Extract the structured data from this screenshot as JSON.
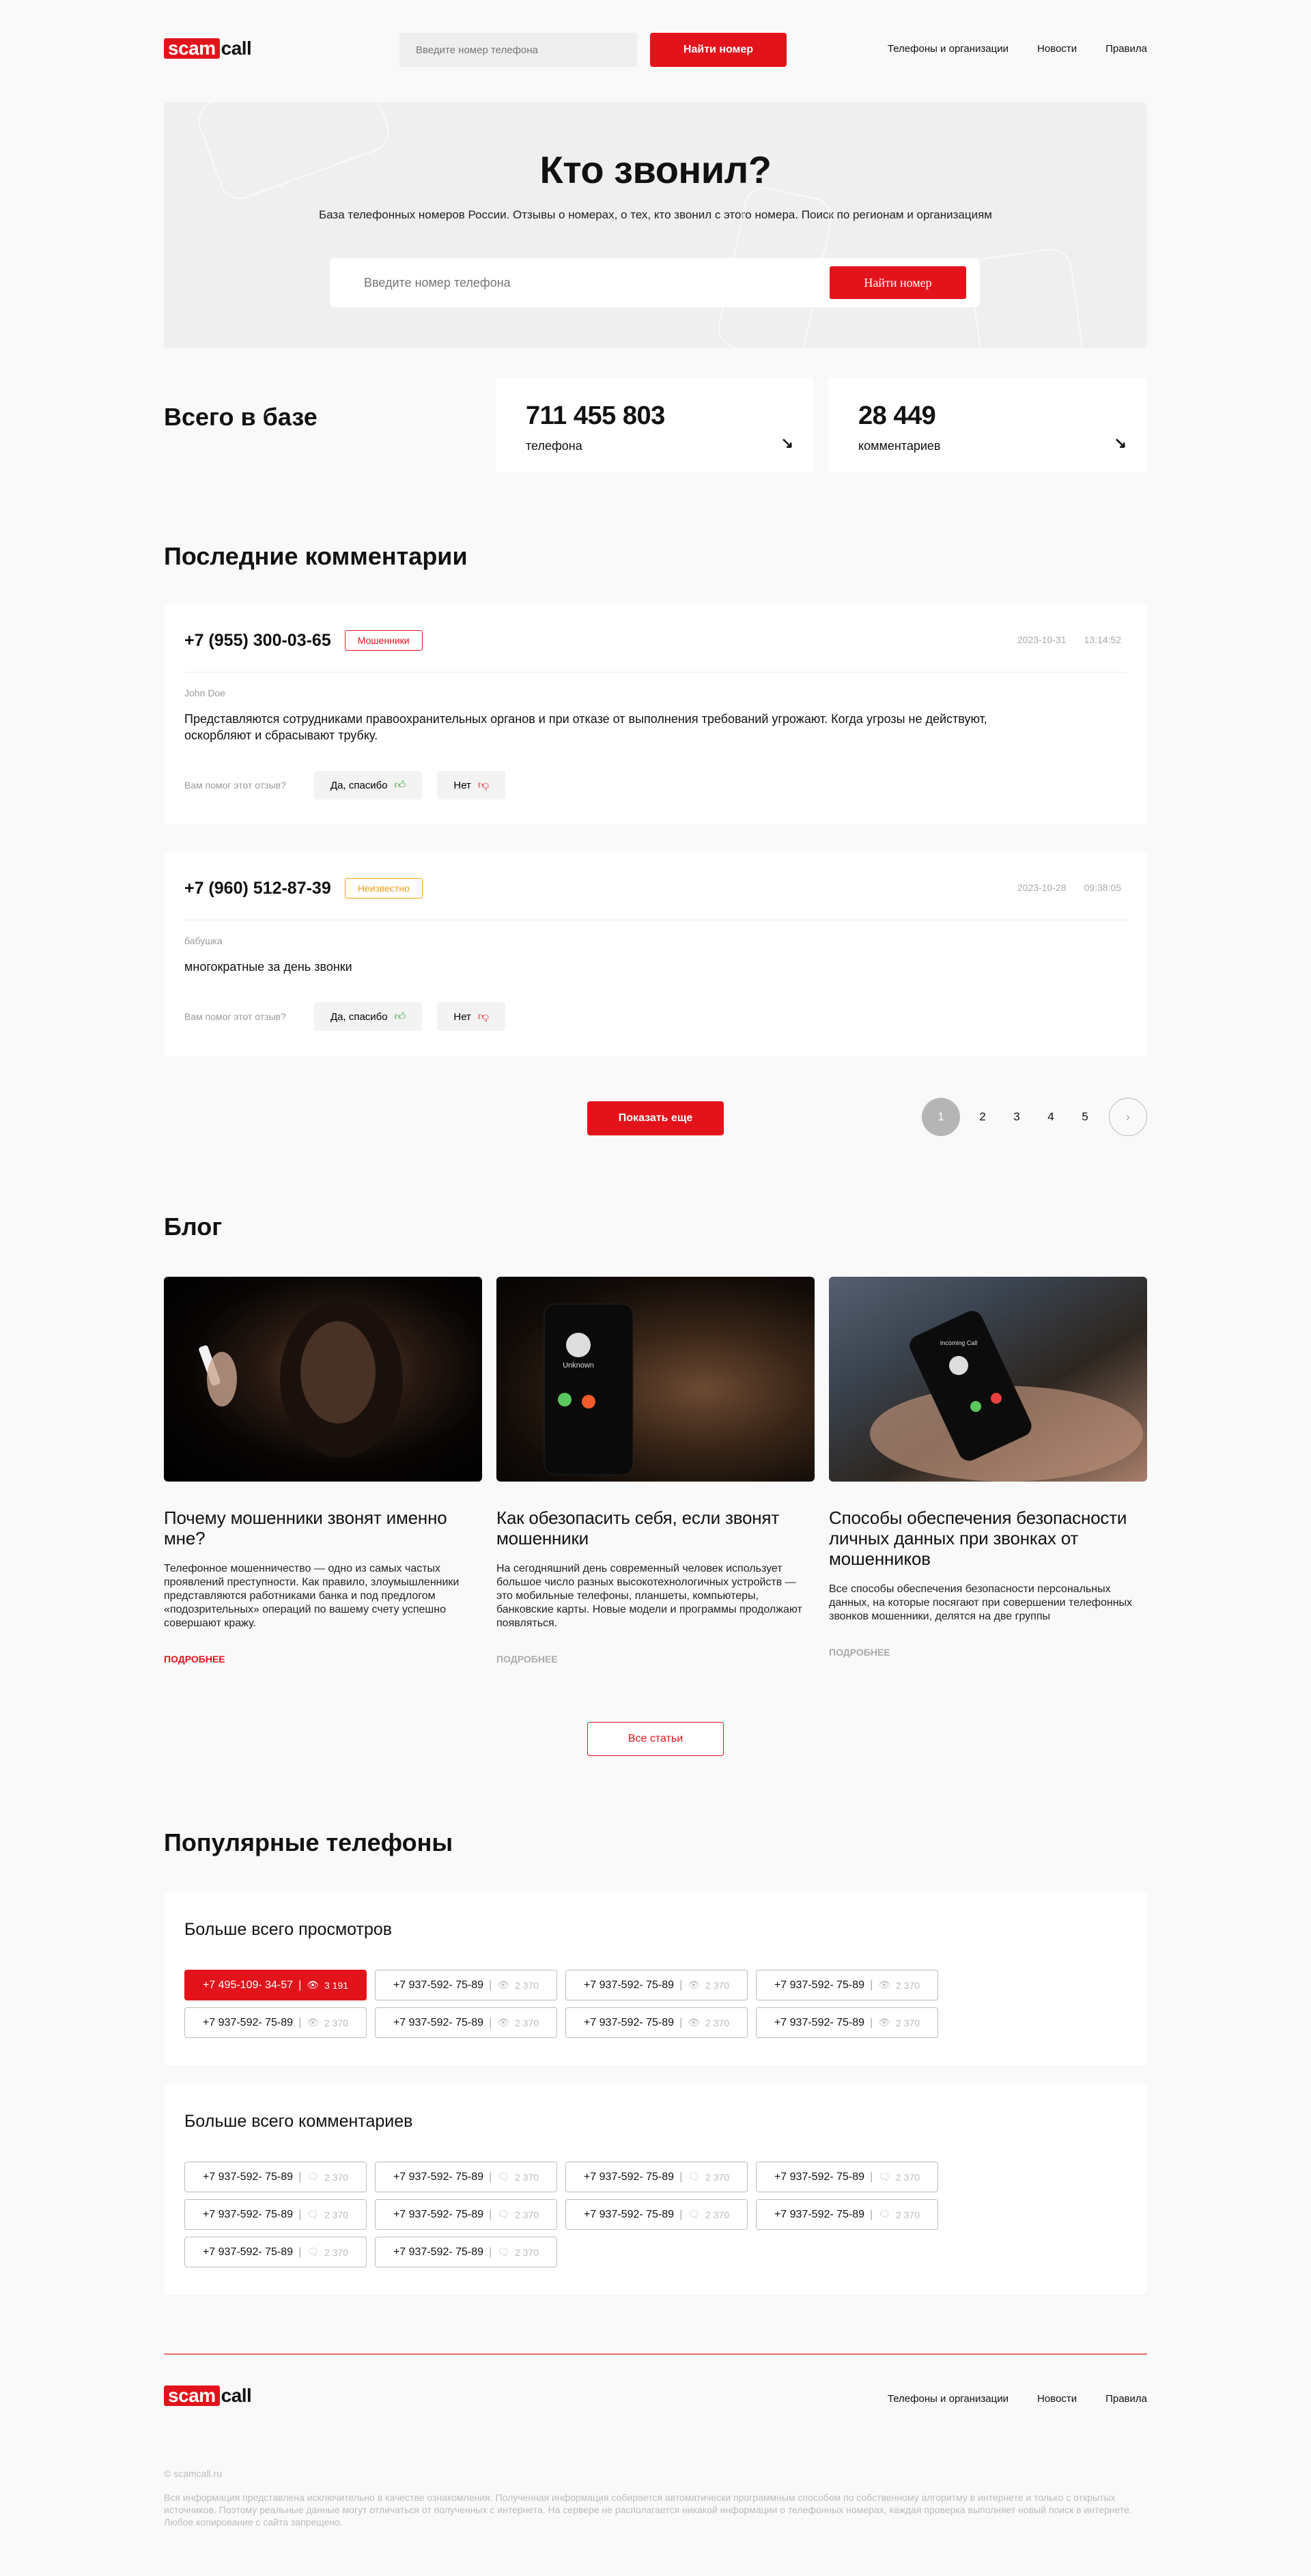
{
  "logo": {
    "scam": "scam",
    "call": "call"
  },
  "header": {
    "search_placeholder": "Введите номер телефона",
    "search_button": "Найти номер",
    "nav": [
      "Телефоны и организации",
      "Новости",
      "Правила"
    ]
  },
  "hero": {
    "title": "Кто звонил?",
    "subtitle": "База телефонных номеров России. Отзывы о номерах, о тех, кто звонил с этого номера. Поиск по регионам и организациям",
    "search_placeholder": "Введите номер телефона",
    "search_button": "Найти номер"
  },
  "stats": {
    "label": "Всего в базе",
    "phones_value": "711 455 803",
    "phones_caption": "телефона",
    "comments_value": "28 449",
    "comments_caption": "комментариев"
  },
  "comments_section": {
    "title": "Последние комментарии",
    "helpful_question": "Вам помог этот отзыв?",
    "yes_label": "Да, спасибо",
    "no_label": "Нет",
    "show_more": "Показать еще",
    "items": [
      {
        "phone": "+7 (955) 300-03-65",
        "tag": "Мошенники",
        "date": "2023-10-31",
        "time": "13:14:52",
        "author": "John Doe",
        "text": "Представляются сотрудниками правоохранительных органов и при отказе от выполнения требований угрожают. Когда угрозы не действуют, оскорбляют и сбрасывают трубку."
      },
      {
        "phone": "+7 (960) 512-87-39",
        "tag": "Неизвестно",
        "date": "2023-10-28",
        "time": "09:38:05",
        "author": "бабушка",
        "text": "многократные за день звонки"
      }
    ],
    "pages": [
      "1",
      "2",
      "3",
      "4",
      "5"
    ],
    "next_icon": "chevron-right-icon"
  },
  "blog": {
    "title": "Блог",
    "read_more": "ПОДРОБНЕЕ",
    "all_button": "Все статьи",
    "posts": [
      {
        "title": "Почему мошенники звонят именно мне?",
        "text": "Телефонное мошенничество — одно из самых частых проявлений преступности. Как правило, злоумышленники представляются работниками банка и под предлогом «подозрительных» операций по вашему счету успешно совершают кражу."
      },
      {
        "title": "Как обезопасить себя, если звонят мошенники",
        "text": "На сегодняшний день современный человек использует большое число разных высокотехнологичных устройств — это мобильные телефоны, планшеты, компьютеры, банковские карты. Новые модели и программы продолжают появляться."
      },
      {
        "title": "Способы обеспечения безопасности личных данных при звонках от мошенников",
        "text": "Все способы обеспечения безопасности персональных данных, на которые посягают при совершении телефонных звонков мошенники, делятся на две группы"
      }
    ],
    "image_texts": {
      "unknown": "Unknown",
      "incoming": "Incoming Call"
    }
  },
  "popular": {
    "title": "Популярные телефоны",
    "views_title": "Больше всего просмотров",
    "comments_title": "Больше всего комментариев",
    "views": [
      {
        "phone": "+7 495-109- 34-57",
        "count": "3 191"
      },
      {
        "phone": "+7 937-592- 75-89",
        "count": "2 370"
      },
      {
        "phone": "+7 937-592- 75-89",
        "count": "2 370"
      },
      {
        "phone": "+7 937-592- 75-89",
        "count": "2 370"
      },
      {
        "phone": "+7 937-592- 75-89",
        "count": "2 370"
      },
      {
        "phone": "+7 937-592- 75-89",
        "count": "2 370"
      },
      {
        "phone": "+7 937-592- 75-89",
        "count": "2 370"
      },
      {
        "phone": "+7 937-592- 75-89",
        "count": "2 370"
      }
    ],
    "comments": [
      {
        "phone": "+7 937-592- 75-89",
        "count": "2 370"
      },
      {
        "phone": "+7 937-592- 75-89",
        "count": "2 370"
      },
      {
        "phone": "+7 937-592- 75-89",
        "count": "2 370"
      },
      {
        "phone": "+7 937-592- 75-89",
        "count": "2 370"
      },
      {
        "phone": "+7 937-592- 75-89",
        "count": "2 370"
      },
      {
        "phone": "+7 937-592- 75-89",
        "count": "2 370"
      },
      {
        "phone": "+7 937-592- 75-89",
        "count": "2 370"
      },
      {
        "phone": "+7 937-592- 75-89",
        "count": "2 370"
      },
      {
        "phone": "+7 937-592- 75-89",
        "count": "2 370"
      },
      {
        "phone": "+7 937-592- 75-89",
        "count": "2 370"
      }
    ]
  },
  "footer": {
    "nav": [
      "Телефоны и организации",
      "Новости",
      "Правила"
    ],
    "copyright": "© scamcall.ru",
    "legal": "Вся информация представлена исключительно в качестве ознакомления. Полученная информация собирается автоматически программным способом по собственному алгоритму в интернете и только с открытых источников. Поэтому реальные данные могут отличаться от полученных с интернета. На сервере не располагается никакой информации о телефонных номерах, каждая проверка выполняет новый поиск в интернете. Любое копирование с сайта запрещено."
  },
  "colors": {
    "accent": "#e3131b",
    "unknown_tag": "#f39c12",
    "background": "#f9f9f9"
  }
}
